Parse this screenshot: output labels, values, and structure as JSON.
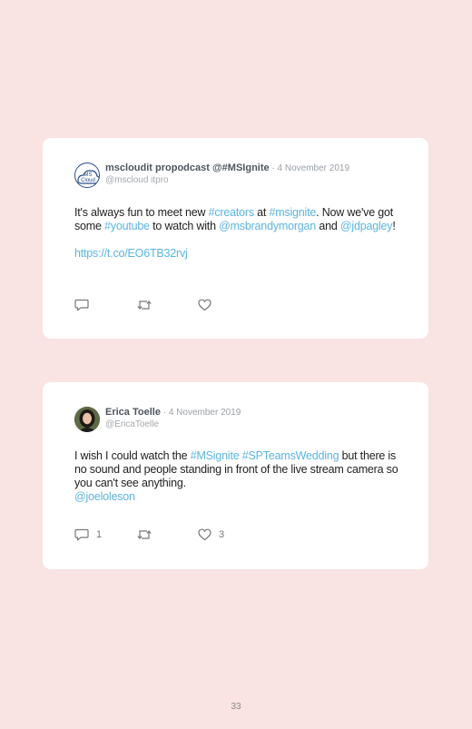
{
  "tweets": [
    {
      "display_name": "mscloudit propodcast @#MSIgnite",
      "separator": " · ",
      "date": "4 November 2019",
      "handle": "@mscloud itpro",
      "body": {
        "p1_a": "It's always fun to meet new ",
        "p1_link1": "#creators",
        "p1_b": " at ",
        "p1_link2": "#msignite",
        "p1_c": ". Now we've got some ",
        "p1_link3": "#youtube",
        "p1_d": " to watch with ",
        "p1_link4": "@msbrandymorgan",
        "p1_e": " and ",
        "p1_link5": "@jdpagley",
        "p1_f": "!",
        "p2_link": "https://t.co/EO6TB32rvj"
      },
      "reply_count": "",
      "retweet_count": "",
      "like_count": ""
    },
    {
      "display_name": "Erica Toelle",
      "separator": " · ",
      "date": "4 November 2019",
      "handle": "@EricaToelle",
      "body": {
        "a": "I wish I could watch the ",
        "link1": "#MSignite",
        "sp": " ",
        "link2": "#SPTeamsWedding",
        "b": " but there is no sound and people standing in front of the live stream camera so you can't see anything.",
        "link3": "@joeloleson"
      },
      "reply_count": "1",
      "retweet_count": "",
      "like_count": "3"
    }
  ],
  "page_number": "33",
  "colors": {
    "background": "#f9e3e3",
    "card": "#ffffff",
    "link": "#5bb5e0"
  },
  "icons": [
    "reply-icon",
    "retweet-icon",
    "like-icon"
  ]
}
